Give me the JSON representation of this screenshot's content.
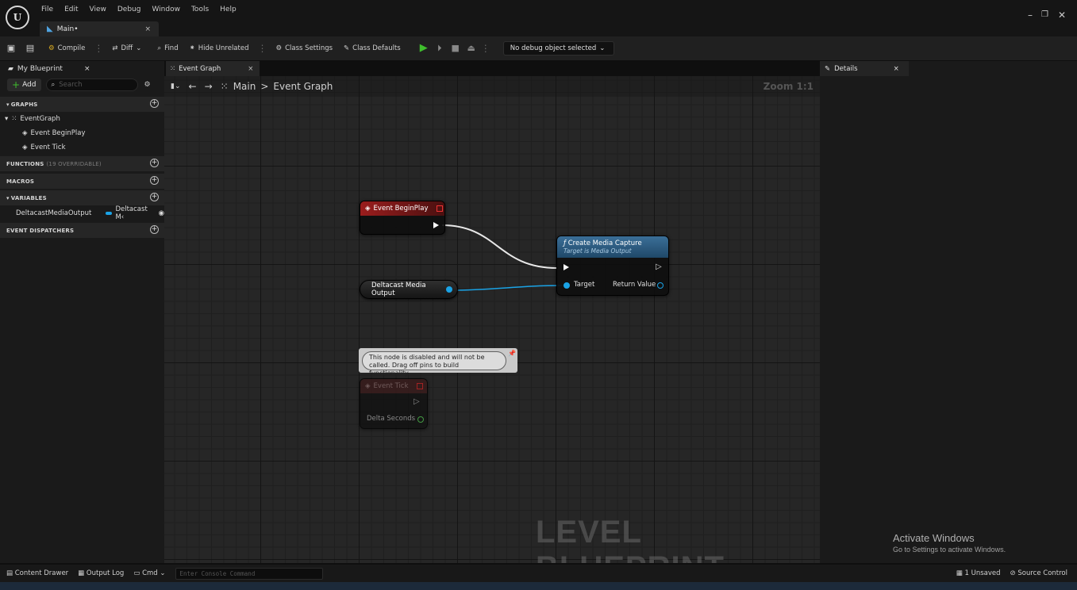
{
  "window": {
    "menu": [
      "File",
      "Edit",
      "View",
      "Debug",
      "Window",
      "Tools",
      "Help"
    ],
    "tab_label": "Main•",
    "logo_text": "U"
  },
  "toolbar": {
    "compile": "Compile",
    "diff": "Diff",
    "find": "Find",
    "hide_unrelated": "Hide Unrelated",
    "class_settings": "Class Settings",
    "class_defaults": "Class Defaults",
    "debug_select": "No debug object selected"
  },
  "left_panel": {
    "tab_label": "My Blueprint",
    "add_label": "Add",
    "search_placeholder": "Search",
    "graphs_header": "GRAPHS",
    "eventgraph_label": "EventGraph",
    "event_beginplay": "Event BeginPlay",
    "event_tick": "Event Tick",
    "functions_header": "FUNCTIONS",
    "functions_count": "(19 OVERRIDABLE)",
    "macros_header": "MACROS",
    "variables_header": "VARIABLES",
    "variable_name": "DeltacastMediaOutput",
    "variable_type": "Deltacast M‹",
    "dispatchers_header": "EVENT DISPATCHERS"
  },
  "graph": {
    "tab_label": "Event Graph",
    "breadcrumb_root": "Main",
    "breadcrumb_sep": ">",
    "breadcrumb_current": "Event Graph",
    "zoom": "Zoom 1:1",
    "watermark": "LEVEL BLUEPRINT",
    "node_beginplay": "Event BeginPlay",
    "node_create_title": "Create Media Capture",
    "node_create_sub": "Target is Media Output",
    "pin_target": "Target",
    "pin_return": "Return Value",
    "var_node_label": "Deltacast Media Output",
    "comment_text": "This node is disabled and will not be called. Drag off pins to build functionality.",
    "node_tick": "Event Tick",
    "pin_delta": "Delta Seconds"
  },
  "details": {
    "tab_label": "Details",
    "activate_title": "Activate Windows",
    "activate_sub": "Go to Settings to activate Windows."
  },
  "statusbar": {
    "content_drawer": "Content Drawer",
    "output_log": "Output Log",
    "cmd": "Cmd",
    "console_placeholder": "Enter Console Command",
    "unsaved": "1 Unsaved",
    "source_control": "Source Control"
  },
  "colors": {
    "exec_wire": "#e8e8e8",
    "object_wire": "#1aa3e6",
    "event_header": "#9a1d1d",
    "function_header": "#3b6f98",
    "play_green": "#3fbe2d"
  }
}
